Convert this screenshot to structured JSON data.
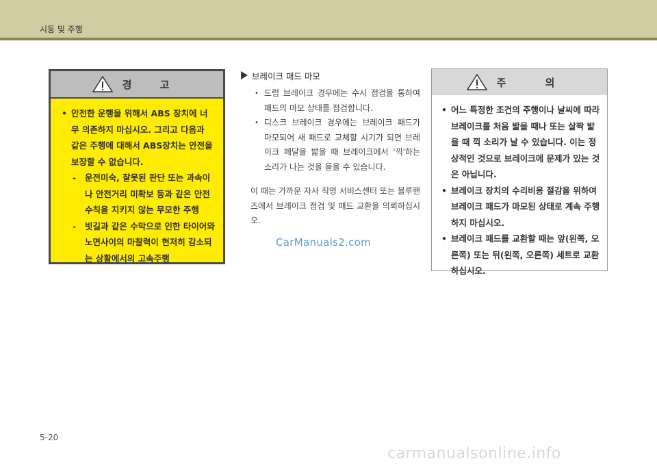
{
  "header": {
    "title": "시동 및 주행"
  },
  "warning": {
    "title": "경 고",
    "bullet": "안전한 운행을 위해서 ABS 장치에 너무 의존하지 마십시오. 그리고 다음과 같은 주행에 대해서 ABS장치는 안전을 보장할 수 없습니다.",
    "dash_mark": "-",
    "items": [
      "운전미숙, 잘못된 판단 또는 과속이나 안전거리 미확보 등과 같은 안전수칙을 지키지 않는 무모한 주행",
      "빗길과 같은 수막으로 인한 타이어와 노면사이의 마찰력이 현저히 감소되는 상황에서의 고속주행"
    ]
  },
  "brake_pad": {
    "title": "브레이크 패드 마모",
    "items": [
      "드럼 브레이크 경우에는 수시 점검을 통하여 패드의 마모 상태를 점검합니다.",
      "디스크 브레이크 경우에는 브레이크 패드가 마모되어 새 패드로 교체할 시기가 되면 브레이크 페달을 밟을 때 브레이크에서 '끽'하는 소리가 나는 것을 들을 수 있습니다."
    ],
    "paragraph": "이 때는 가까운 자사 직영 서비스센터 또는 블루핸즈에서 브레이크 점검 및 패드 교환을 의뢰하십시오."
  },
  "watermark": "CarManuals2.com",
  "caution": {
    "title": "주 의",
    "items": [
      "어느 특정한 조건의 주행이나 날씨에 따라 브레이크를 처음 밟을 때나 또는 살짝 밟을 때 끽 소리가 날 수 있습니다. 이는 정상적인 것으로 브레이크에 문제가 있는 것은 아닙니다.",
      "브레이크 장치의 수리비용 절감을 위하여 브레이크 패드가 마모된 상태로 계속 주행하지 마십시오.",
      "브레이크 패드를 교환할 때는 앞(왼쪽, 오른쪽) 또는 뒤(왼쪽, 오른쪽) 세트로 교환하십시오."
    ]
  },
  "page_number": "5-20",
  "footer_watermark": "carmanualsonline.info",
  "colors": {
    "header_bg": "#d1cda2",
    "header_bar": "#8c8452",
    "warning_bg": "#ffec00"
  }
}
